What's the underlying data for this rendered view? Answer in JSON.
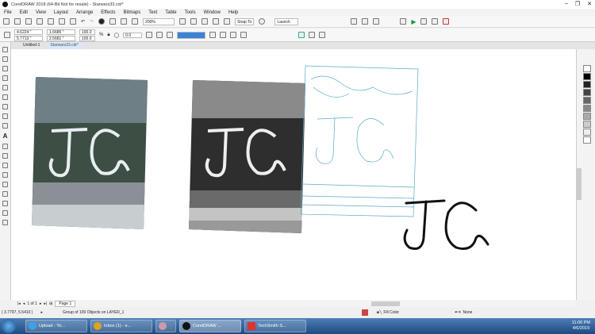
{
  "window": {
    "title": "CorelDRAW 2018 (64-Bit Not for resale) - Starwars33.cdr*"
  },
  "menu": [
    "File",
    "Edit",
    "View",
    "Layout",
    "Arrange",
    "Effects",
    "Bitmaps",
    "Text",
    "Table",
    "Tools",
    "Window",
    "Help"
  ],
  "toolbar": {
    "zoom": "200%",
    "snap": "Snap To",
    "launch": "Launch"
  },
  "propbar": {
    "x": "4.6224 \"",
    "y": "5.7713 \"",
    "w": "1.6685 \"",
    "h": "2.5681 \"",
    "sx": "100.0",
    "sy": "100.0",
    "pct": "%",
    "angle": "0.0"
  },
  "tabs": [
    "Untitled-1",
    "Starwars33.cdr*"
  ],
  "pager": {
    "counter": "1 of 1",
    "page": "Page 1"
  },
  "status": {
    "coords": "( 3.7797, 5.5410 )",
    "selection": "Group of 109 Objects on LAYER_1",
    "fill": "Fill Color",
    "outline": "None"
  },
  "taskbar": {
    "items": [
      "Upload - Yo...",
      "Inbox (1) - e...",
      "CorelDRAW ...",
      "TechSmith S..."
    ],
    "time": "11:00 PM",
    "date": "4/6/2019"
  },
  "canvas": {
    "logo_text": "JC"
  },
  "colors": {
    "outline": "#5aa9c9",
    "taskbar": "#2a5a94"
  }
}
